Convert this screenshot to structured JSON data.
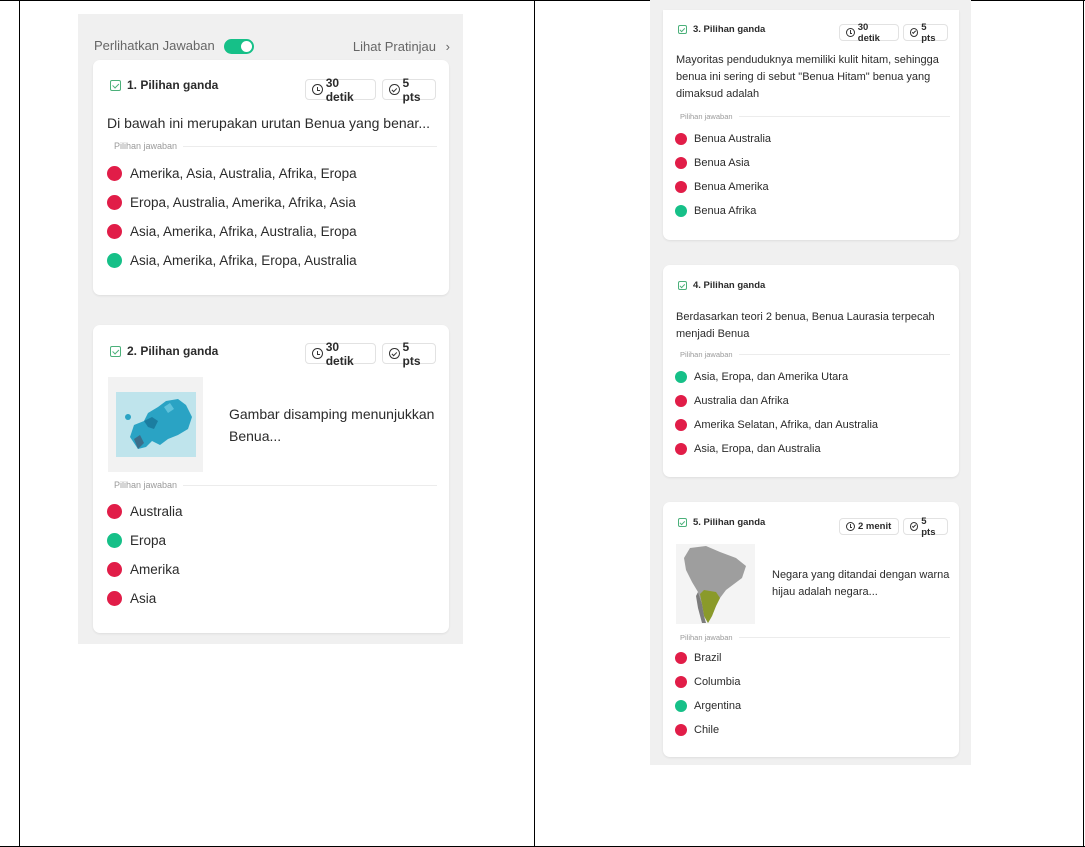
{
  "topbar": {
    "show_answers": "Perlihatkan Jawaban",
    "preview": "Lihat Pratinjau",
    "chevron": "›"
  },
  "options_label": "Pilihan jawaban",
  "colors": {
    "wrong": "#e11d48",
    "correct": "#16c088",
    "accent": "#16c088"
  },
  "questions": [
    {
      "title": "1. Pilihan ganda",
      "time": "30 detik",
      "points": "5 pts",
      "text": "Di bawah ini merupakan urutan Benua yang benar...",
      "options": [
        {
          "label": "Amerika, Asia, Australia, Afrika, Eropa",
          "correct": false
        },
        {
          "label": "Eropa, Australia, Amerika, Afrika, Asia",
          "correct": false
        },
        {
          "label": "Asia, Amerika, Afrika, Australia, Eropa",
          "correct": false
        },
        {
          "label": "Asia, Amerika, Afrika, Eropa, Australia",
          "correct": true
        }
      ]
    },
    {
      "title": "2. Pilihan ganda",
      "time": "30 detik",
      "points": "5 pts",
      "text": "Gambar disamping menunjukkan Benua...",
      "options": [
        {
          "label": "Australia",
          "correct": false
        },
        {
          "label": "Eropa",
          "correct": true
        },
        {
          "label": "Amerika",
          "correct": false
        },
        {
          "label": "Asia",
          "correct": false
        }
      ]
    },
    {
      "title": "3. Pilihan ganda",
      "time": "30 detik",
      "points": "5 pts",
      "text": "Mayoritas penduduknya memiliki kulit hitam, sehingga benua ini sering di sebut \"Benua Hitam\" benua yang dimaksud adalah",
      "options": [
        {
          "label": "Benua Australia",
          "correct": false
        },
        {
          "label": "Benua Asia",
          "correct": false
        },
        {
          "label": "Benua Amerika",
          "correct": false
        },
        {
          "label": "Benua Afrika",
          "correct": true
        }
      ]
    },
    {
      "title": "4. Pilihan ganda",
      "text": "Berdasarkan teori 2 benua, Benua Laurasia terpecah menjadi Benua",
      "options": [
        {
          "label": "Asia, Eropa, dan Amerika Utara",
          "correct": true
        },
        {
          "label": "Australia dan Afrika",
          "correct": false
        },
        {
          "label": "Amerika Selatan, Afrika, dan Australia",
          "correct": false
        },
        {
          "label": "Asia, Eropa, dan Australia",
          "correct": false
        }
      ]
    },
    {
      "title": "5. Pilihan ganda",
      "time": "2 menit",
      "points": "5 pts",
      "text": "Negara yang ditandai dengan warna hijau adalah negara...",
      "options": [
        {
          "label": "Brazil",
          "correct": false
        },
        {
          "label": "Columbia",
          "correct": false
        },
        {
          "label": "Argentina",
          "correct": true
        },
        {
          "label": "Chile",
          "correct": false
        }
      ]
    }
  ]
}
